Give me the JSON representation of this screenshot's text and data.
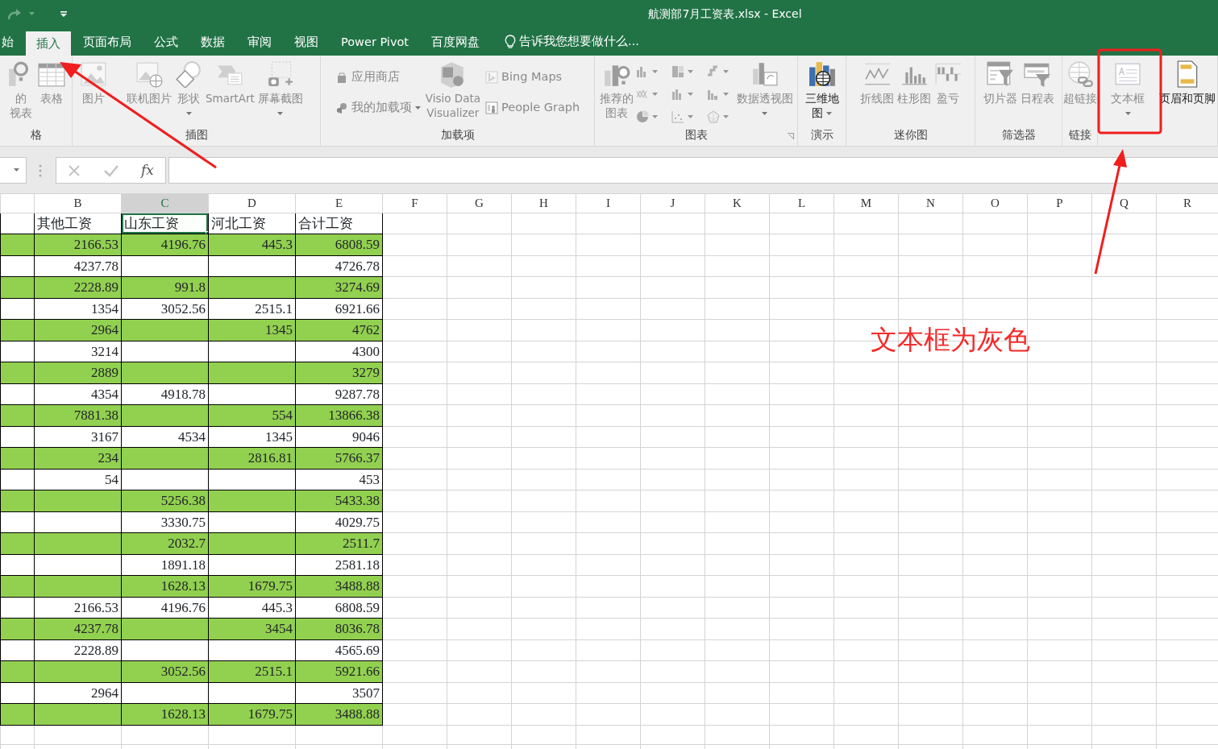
{
  "title_bar": {
    "title": "航测部7月工资表.xlsx - Excel"
  },
  "ribbon_tabs": [
    {
      "label": "始",
      "selected": false
    },
    {
      "label": "插入",
      "selected": true
    },
    {
      "label": "页面布局",
      "selected": false
    },
    {
      "label": "公式",
      "selected": false
    },
    {
      "label": "数据",
      "selected": false
    },
    {
      "label": "审阅",
      "selected": false
    },
    {
      "label": "视图",
      "selected": false
    },
    {
      "label": "Power Pivot",
      "selected": false
    },
    {
      "label": "百度网盘",
      "selected": false
    }
  ],
  "tell_me": {
    "text": "告诉我您想要做什么..."
  },
  "ribbon_groups": [
    {
      "label": "格",
      "items": [
        {
          "kind": "large",
          "lines": [
            "的",
            "视表"
          ],
          "disabled": true
        },
        {
          "kind": "large",
          "lines": [
            "表格"
          ],
          "disabled": true
        }
      ]
    },
    {
      "label": "插图",
      "items": [
        {
          "kind": "large",
          "lines": [
            "图片"
          ],
          "disabled": true
        },
        {
          "kind": "large",
          "lines": [
            "联机图片"
          ],
          "disabled": true
        },
        {
          "kind": "large",
          "lines": [
            "形状"
          ],
          "disabled": true,
          "caret": true
        },
        {
          "kind": "large",
          "lines": [
            "SmartArt"
          ],
          "disabled": true
        },
        {
          "kind": "large",
          "lines": [
            "屏幕截图"
          ],
          "disabled": true,
          "caret": true
        }
      ]
    },
    {
      "label": "加载项",
      "items": [
        {
          "kind": "small",
          "lines": [
            "应用商店"
          ],
          "disabled": true
        },
        {
          "kind": "small",
          "lines": [
            "我的加载项"
          ],
          "disabled": true,
          "caret": true
        },
        {
          "kind": "large",
          "lines": [
            "Visio Data",
            "Visualizer"
          ],
          "disabled": true
        },
        {
          "kind": "small",
          "lines": [
            "Bing Maps"
          ],
          "disabled": true
        },
        {
          "kind": "small",
          "lines": [
            "People Graph"
          ],
          "disabled": true
        }
      ]
    },
    {
      "label": "图表",
      "launcher": true,
      "items": [
        {
          "kind": "large",
          "lines": [
            "推荐的",
            "图表"
          ],
          "disabled": true
        },
        {
          "kind": "chart-grid",
          "disabled": true
        },
        {
          "kind": "large",
          "lines": [
            "数据透视图"
          ],
          "disabled": true,
          "caret": true
        }
      ]
    },
    {
      "label": "演示",
      "items": [
        {
          "kind": "large",
          "lines": [
            "三维地",
            "图"
          ],
          "disabled": false,
          "caret": true
        }
      ]
    },
    {
      "label": "迷你图",
      "items": [
        {
          "kind": "large",
          "lines": [
            "折线图"
          ],
          "disabled": true
        },
        {
          "kind": "large",
          "lines": [
            "柱形图"
          ],
          "disabled": true
        },
        {
          "kind": "large",
          "lines": [
            "盈亏"
          ],
          "disabled": true
        }
      ]
    },
    {
      "label": "筛选器",
      "items": [
        {
          "kind": "large",
          "lines": [
            "切片器"
          ],
          "disabled": true
        },
        {
          "kind": "large",
          "lines": [
            "日程表"
          ],
          "disabled": true
        }
      ]
    },
    {
      "label": "链接",
      "items": [
        {
          "kind": "large",
          "lines": [
            "超链接"
          ],
          "disabled": true
        }
      ]
    },
    {
      "items": [
        {
          "kind": "large",
          "lines": [
            "文本框"
          ],
          "disabled": true,
          "caret": true
        },
        {
          "kind": "large",
          "lines": [
            "页眉和页脚"
          ],
          "disabled": false
        }
      ]
    }
  ],
  "formula_bar": {
    "function_label": "fx"
  },
  "columns": [
    {
      "label": "B",
      "selected": false
    },
    {
      "label": "C",
      "selected": true
    },
    {
      "label": "D",
      "selected": false
    },
    {
      "label": "E",
      "selected": false
    },
    {
      "label": "F",
      "selected": false
    },
    {
      "label": "G",
      "selected": false
    },
    {
      "label": "H",
      "selected": false
    },
    {
      "label": "I",
      "selected": false
    },
    {
      "label": "J",
      "selected": false
    },
    {
      "label": "K",
      "selected": false
    },
    {
      "label": "L",
      "selected": false
    },
    {
      "label": "M",
      "selected": false
    },
    {
      "label": "N",
      "selected": false
    },
    {
      "label": "O",
      "selected": false
    },
    {
      "label": "P",
      "selected": false
    },
    {
      "label": "Q",
      "selected": false
    },
    {
      "label": "R",
      "selected": false
    }
  ],
  "header_row": [
    {
      "text": "其他工资",
      "selected": false
    },
    {
      "text": "山东工资",
      "selected": true
    },
    {
      "text": "河北工资",
      "selected": false
    },
    {
      "text": "合计工资",
      "selected": false
    }
  ],
  "rows": [
    {
      "highlighted": true,
      "cells": [
        "2166.53",
        "4196.76",
        "445.3",
        "6808.59"
      ]
    },
    {
      "highlighted": false,
      "cells": [
        "4237.78",
        null,
        null,
        "4726.78"
      ]
    },
    {
      "highlighted": true,
      "cells": [
        "2228.89",
        "991.8",
        null,
        "3274.69"
      ]
    },
    {
      "highlighted": false,
      "cells": [
        "1354",
        "3052.56",
        "2515.1",
        "6921.66"
      ]
    },
    {
      "highlighted": true,
      "cells": [
        "2964",
        null,
        "1345",
        "4762"
      ]
    },
    {
      "highlighted": false,
      "cells": [
        "3214",
        null,
        null,
        "4300"
      ]
    },
    {
      "highlighted": true,
      "cells": [
        "2889",
        null,
        null,
        "3279"
      ]
    },
    {
      "highlighted": false,
      "cells": [
        "4354",
        "4918.78",
        null,
        "9287.78"
      ]
    },
    {
      "highlighted": true,
      "cells": [
        "7881.38",
        null,
        "554",
        "13866.38"
      ]
    },
    {
      "highlighted": false,
      "cells": [
        "3167",
        "4534",
        "1345",
        "9046"
      ]
    },
    {
      "highlighted": true,
      "cells": [
        "234",
        null,
        "2816.81",
        "5766.37"
      ]
    },
    {
      "highlighted": false,
      "cells": [
        "54",
        null,
        null,
        "453"
      ]
    },
    {
      "highlighted": true,
      "cells": [
        null,
        "5256.38",
        null,
        "5433.38"
      ]
    },
    {
      "highlighted": false,
      "cells": [
        null,
        "3330.75",
        null,
        "4029.75"
      ]
    },
    {
      "highlighted": true,
      "cells": [
        null,
        "2032.7",
        null,
        "2511.7"
      ]
    },
    {
      "highlighted": false,
      "cells": [
        null,
        "1891.18",
        null,
        "2581.18"
      ]
    },
    {
      "highlighted": true,
      "cells": [
        null,
        "1628.13",
        "1679.75",
        "3488.88"
      ]
    },
    {
      "highlighted": false,
      "cells": [
        "2166.53",
        "4196.76",
        "445.3",
        "6808.59"
      ]
    },
    {
      "highlighted": true,
      "cells": [
        "4237.78",
        null,
        "3454",
        "8036.78"
      ]
    },
    {
      "highlighted": false,
      "cells": [
        "2228.89",
        null,
        null,
        "4565.69"
      ]
    },
    {
      "highlighted": true,
      "cells": [
        null,
        "3052.56",
        "2515.1",
        "5921.66"
      ]
    },
    {
      "highlighted": false,
      "cells": [
        "2964",
        null,
        null,
        "3507"
      ]
    },
    {
      "highlighted": true,
      "cells": [
        null,
        "1628.13",
        "1679.75",
        "3488.88"
      ]
    }
  ],
  "annotation": {
    "text": "文本框为灰色"
  }
}
